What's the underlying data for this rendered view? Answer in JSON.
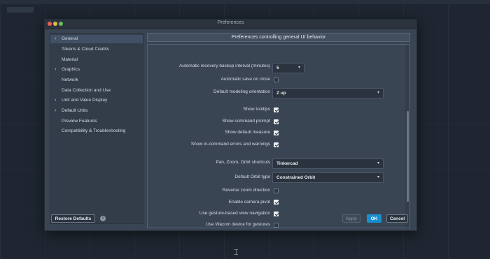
{
  "window": {
    "title": "Preferences"
  },
  "sidebar": {
    "items": [
      {
        "label": "General",
        "chevron": "›",
        "selected": true
      },
      {
        "label": "Tokens & Cloud Credits",
        "chevron": ""
      },
      {
        "label": "Material",
        "chevron": ""
      },
      {
        "label": "Graphics",
        "chevron": "›"
      },
      {
        "label": "Network",
        "chevron": ""
      },
      {
        "label": "Data Collection and Use",
        "chevron": ""
      },
      {
        "label": "Unit and Value Display",
        "chevron": "›"
      },
      {
        "label": "Default Units",
        "chevron": "›"
      },
      {
        "label": "Preview Features",
        "chevron": ""
      },
      {
        "label": "Compatibility & Troubleshooting",
        "chevron": ""
      }
    ]
  },
  "banner": {
    "text": "Preferences controlling general UI behavior"
  },
  "settings": {
    "recovery_interval": {
      "label": "Automatic recovery backup interval (minutes)",
      "value": "5"
    },
    "autosave": {
      "label": "Automatic save on close",
      "checked": false
    },
    "modeling_orientation": {
      "label": "Default modeling orientation",
      "value": "Z up"
    },
    "show_tooltips": {
      "label": "Show tooltips",
      "checked": true
    },
    "show_command_prompt": {
      "label": "Show command prompt",
      "checked": true
    },
    "show_default_measure": {
      "label": "Show default measure",
      "checked": true
    },
    "show_incommand_errors": {
      "label": "Show in-command errors and warnings",
      "checked": true
    },
    "pan_zoom_orbit": {
      "label": "Pan, Zoom, Orbit shortcuts",
      "value": "Tinkercad"
    },
    "default_orbit_type": {
      "label": "Default Orbit type",
      "value": "Constrained Orbit"
    },
    "reverse_zoom": {
      "label": "Reverse zoom direction",
      "checked": false
    },
    "camera_pivot": {
      "label": "Enable camera pivot",
      "checked": true
    },
    "gesture_navigation": {
      "label": "Use gesture-based view navigation",
      "checked": true
    },
    "wacom": {
      "label": "Use Wacom device for gestures",
      "checked": false
    }
  },
  "footer": {
    "restore_label": "Restore Defaults",
    "info_icon": "i",
    "apply_label": "Apply",
    "ok_label": "OK",
    "cancel_label": "Cancel"
  },
  "icons": {
    "caret": "▾",
    "chevron": "›",
    "cursor": "⌶"
  },
  "colors": {
    "accent": "#1a8fd0",
    "window_bg": "#3a4554",
    "desktop_bg": "#1f2631"
  }
}
